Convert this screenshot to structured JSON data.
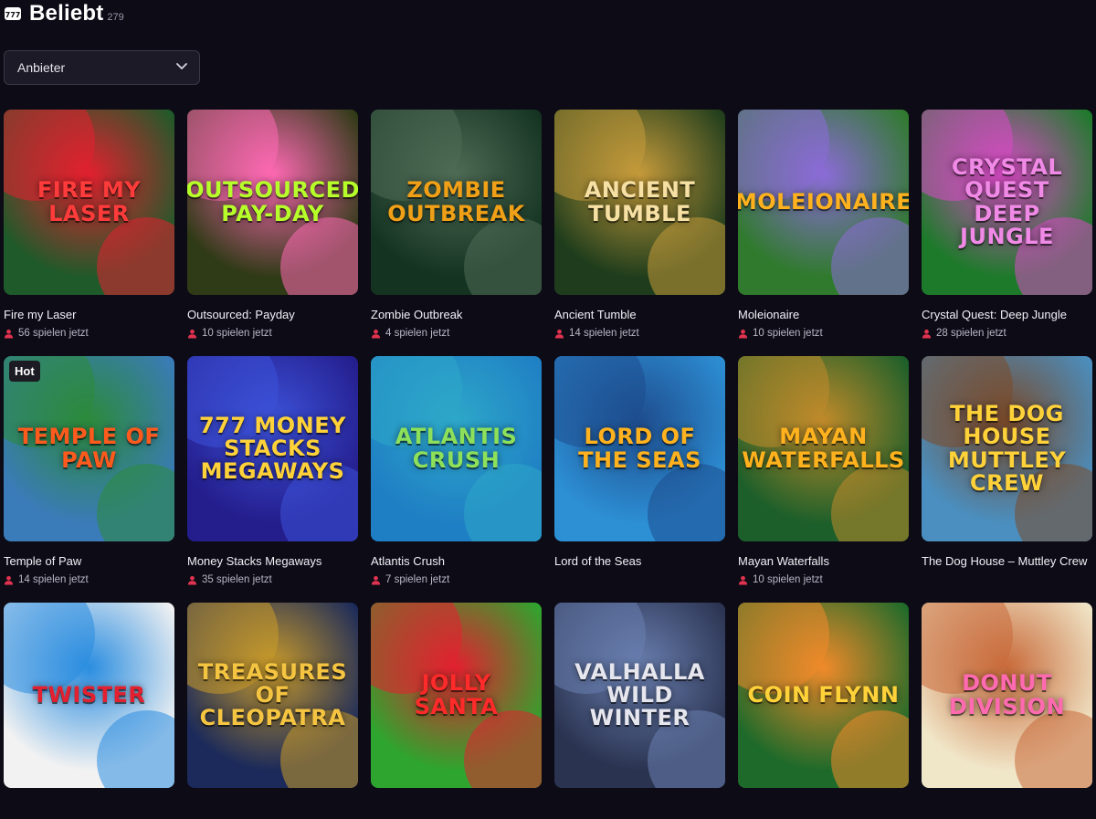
{
  "header": {
    "title": "Beliebt",
    "count": "279",
    "icon": "slot-777-icon"
  },
  "filter": {
    "label": "Anbieter",
    "icon": "chevron-down-icon"
  },
  "colors": {
    "background": "#0d0b16",
    "players_icon": "#e0334f"
  },
  "games": [
    {
      "name": "Fire my Laser",
      "players": "56 spielen jetzt",
      "thumb_text": "Fire my Laser",
      "bg": "#1f5a2a",
      "accent": "#e3202f",
      "text_color": "#ff3b3b"
    },
    {
      "name": "Outsourced: Payday",
      "players": "10 spielen jetzt",
      "thumb_text": "Outsourced Pay-Day",
      "bg": "#2f3a16",
      "accent": "#ff69b4",
      "text_color": "#b7ff2a"
    },
    {
      "name": "Zombie Outbreak",
      "players": "4 spielen jetzt",
      "thumb_text": "Zombie Outbreak",
      "bg": "#143321",
      "accent": "#4e6b55",
      "text_color": "#f0a017"
    },
    {
      "name": "Ancient Tumble",
      "players": "14 spielen jetzt",
      "thumb_text": "Ancient Tumble",
      "bg": "#1f3d1c",
      "accent": "#c59a3b",
      "text_color": "#f7e0a3"
    },
    {
      "name": "Moleionaire",
      "players": "10 spielen jetzt",
      "thumb_text": "Moleionaire",
      "bg": "#2f7a2c",
      "accent": "#8c6bd8",
      "text_color": "#ffb21e"
    },
    {
      "name": "Crystal Quest: Deep Jungle",
      "players": "28 spielen jetzt",
      "thumb_text": "Crystal Quest Deep Jungle",
      "bg": "#1d7a2a",
      "accent": "#d94ac6",
      "text_color": "#f08ae6"
    },
    {
      "name": "Temple of Paw",
      "players": "14 spielen jetzt",
      "thumb_text": "Temple of Paw",
      "bg": "#3a7bb9",
      "accent": "#2c8a3a",
      "text_color": "#ff5a1e",
      "badge": "Hot"
    },
    {
      "name": "Money Stacks Megaways",
      "players": "35 spielen jetzt",
      "thumb_text": "777 Money Stacks Megaways",
      "bg": "#241d8c",
      "accent": "#3c52d9",
      "text_color": "#ffd23a"
    },
    {
      "name": "Atlantis Crush",
      "players": "7 spielen jetzt",
      "thumb_text": "Atlantis Crush",
      "bg": "#1f7fc4",
      "accent": "#2da7c9",
      "text_color": "#8ce05a"
    },
    {
      "name": "Lord of the Seas",
      "players": "",
      "thumb_text": "Lord of the Seas",
      "bg": "#2d8fd4",
      "accent": "#1e4d8e",
      "text_color": "#ffb21e"
    },
    {
      "name": "Mayan Waterfalls",
      "players": "10 spielen jetzt",
      "thumb_text": "Mayan Waterfalls",
      "bg": "#1c5f2a",
      "accent": "#c08a2a",
      "text_color": "#ffb21e"
    },
    {
      "name": "The Dog House – Muttley Crew",
      "players": "",
      "thumb_text": "The Dog House Muttley Crew",
      "bg": "#4a8fc0",
      "accent": "#7a4a2a",
      "text_color": "#ffd23a"
    },
    {
      "name": "",
      "players": "",
      "thumb_text": "Twister",
      "bg": "#f2f2f2",
      "accent": "#2a8de0",
      "text_color": "#e3202f"
    },
    {
      "name": "",
      "players": "",
      "thumb_text": "Treasures of Cleopatra",
      "bg": "#1b2a5a",
      "accent": "#c89a2a",
      "text_color": "#f5c542"
    },
    {
      "name": "",
      "players": "",
      "thumb_text": "Jolly Santa",
      "bg": "#2ea52e",
      "accent": "#e3202f",
      "text_color": "#ff2a2a"
    },
    {
      "name": "",
      "players": "",
      "thumb_text": "Valhalla Wild Winter",
      "bg": "#2a3350",
      "accent": "#6a7fb0",
      "text_color": "#e6e6ee"
    },
    {
      "name": "",
      "players": "",
      "thumb_text": "Coin Flynn",
      "bg": "#1e6a2a",
      "accent": "#f08a2a",
      "text_color": "#ffd23a"
    },
    {
      "name": "",
      "players": "",
      "thumb_text": "Donut Division",
      "bg": "#f0e6c8",
      "accent": "#c86a3a",
      "text_color": "#ff6ab0"
    }
  ]
}
